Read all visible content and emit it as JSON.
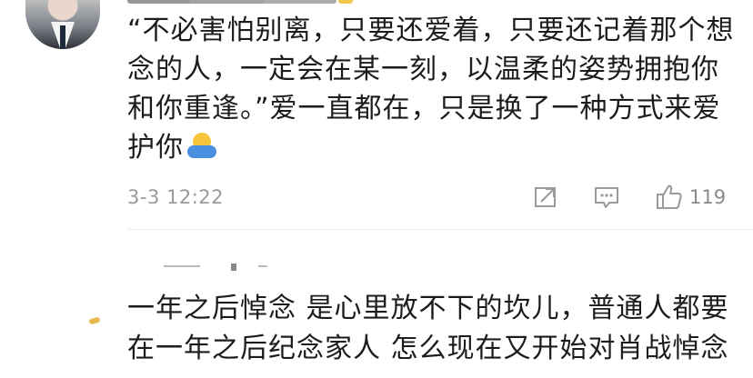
{
  "comment_1": {
    "content_main": "“不必害怕别离，只要还爱着，只要还记着那个想念的人，一定会在某一刻，以温柔的姿势拥抱你和你重逢。”爱一直都在，只是换了一种方式来爱护你",
    "emoji_icon": "hug-emoji",
    "timestamp": "3-3 12:22",
    "like_count": "119",
    "icons": {
      "share": "share-icon",
      "comment": "comment-icon",
      "like": "thumbs-up-icon"
    }
  },
  "comment_2": {
    "content_main": "一年之后悼念 是心里放不下的坎儿，普通人都要在一年之后纪念家人 怎么现在又开始对肖战悼念"
  },
  "colors": {
    "text": "#1c1c1c",
    "meta": "#9a9a9a",
    "divider": "#ececec"
  }
}
